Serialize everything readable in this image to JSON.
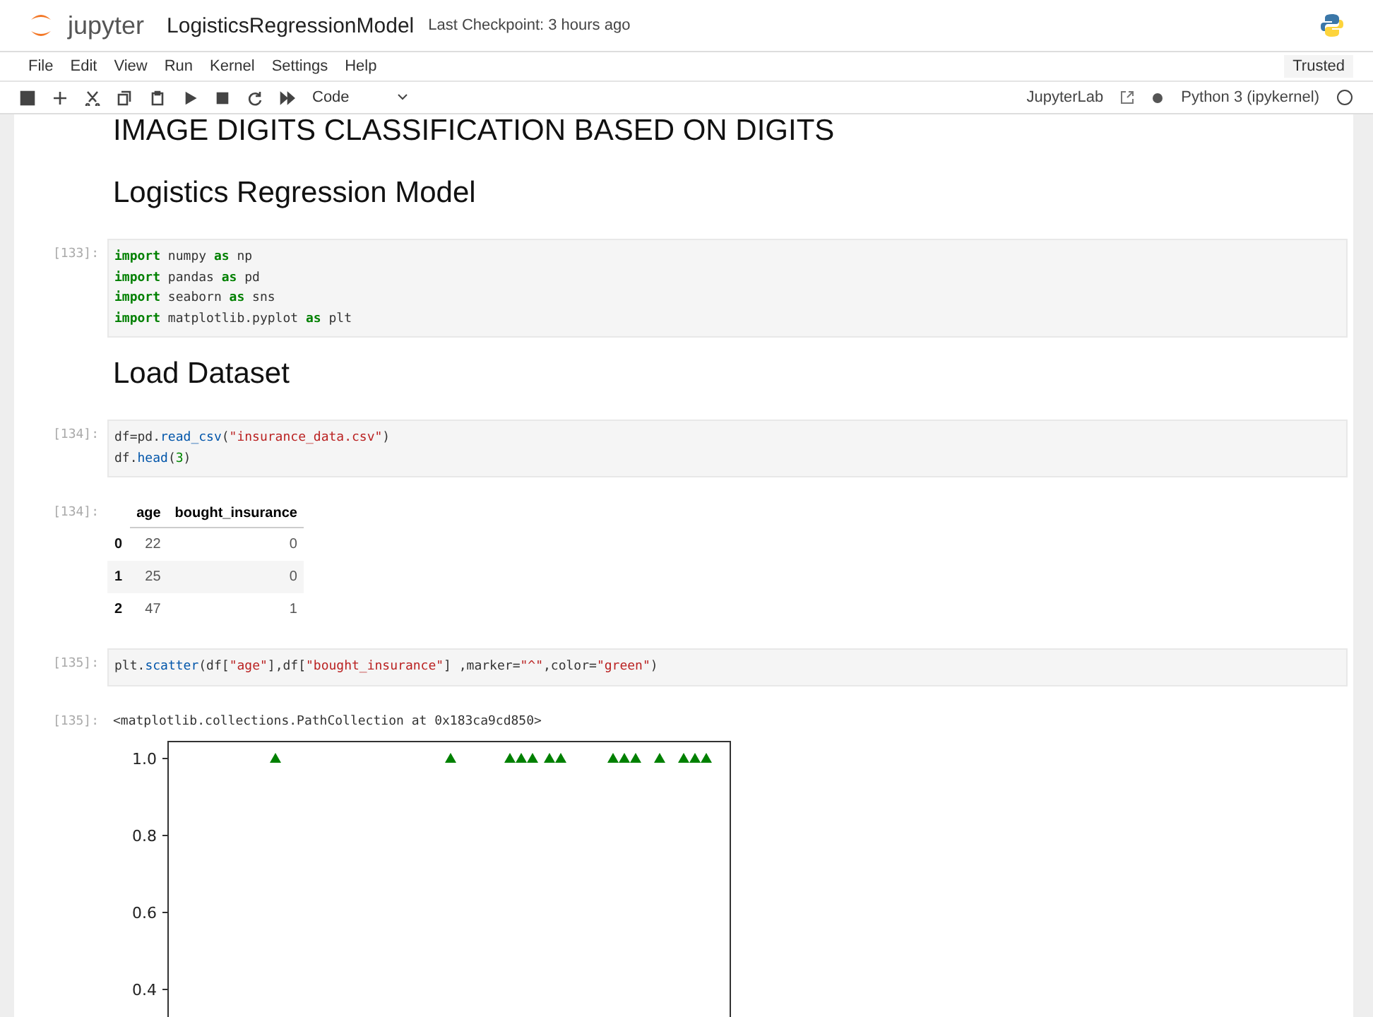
{
  "header": {
    "logo": "jupyter",
    "notebook_name": "LogisticsRegressionModel",
    "checkpoint": "Last Checkpoint: 3 hours ago"
  },
  "menu": [
    "File",
    "Edit",
    "View",
    "Run",
    "Kernel",
    "Settings",
    "Help"
  ],
  "trusted": "Trusted",
  "toolbar": {
    "cell_type": "Code",
    "jupyterlab": "JupyterLab",
    "kernel": "Python 3 (ipykernel)",
    "kernel_busy": false
  },
  "cells": [
    {
      "kind": "title",
      "text": "IMAGE DIGITS CLASSIFICATION BASED ON DIGITS"
    },
    {
      "kind": "heading",
      "text": "Logistics Regression Model"
    },
    {
      "kind": "code",
      "prompt": "[133]:",
      "lines": [
        [
          {
            "text": "import",
            "kind": "keyword"
          },
          {
            "text": " numpy ",
            "kind": "plain"
          },
          {
            "text": "as",
            "kind": "keyword"
          },
          {
            "text": " np",
            "kind": "plain"
          }
        ],
        [
          {
            "text": "import",
            "kind": "keyword"
          },
          {
            "text": " pandas ",
            "kind": "plain"
          },
          {
            "text": "as",
            "kind": "keyword"
          },
          {
            "text": " pd",
            "kind": "plain"
          }
        ],
        [
          {
            "text": "import",
            "kind": "keyword"
          },
          {
            "text": " seaborn ",
            "kind": "plain"
          },
          {
            "text": "as",
            "kind": "keyword"
          },
          {
            "text": " sns",
            "kind": "plain"
          }
        ],
        [
          {
            "text": "import",
            "kind": "keyword"
          },
          {
            "text": " matplotlib.pyplot ",
            "kind": "plain"
          },
          {
            "text": "as",
            "kind": "keyword"
          },
          {
            "text": " plt",
            "kind": "plain"
          }
        ]
      ]
    },
    {
      "kind": "heading",
      "text": "Load Dataset"
    },
    {
      "kind": "code",
      "prompt": "[134]:",
      "lines": [
        [
          {
            "text": "df=pd.",
            "kind": "plain"
          },
          {
            "text": "read_csv",
            "kind": "function"
          },
          {
            "text": "(",
            "kind": "plain"
          },
          {
            "text": "\"insurance_data.csv\"",
            "kind": "string"
          },
          {
            "text": ")",
            "kind": "plain"
          }
        ],
        [
          {
            "text": "df.",
            "kind": "plain"
          },
          {
            "text": "head",
            "kind": "function"
          },
          {
            "text": "(",
            "kind": "plain"
          },
          {
            "text": "3",
            "kind": "number"
          },
          {
            "text": ")",
            "kind": "plain"
          }
        ]
      ]
    },
    {
      "kind": "table",
      "prompt": "[134]:",
      "columns": [
        "age",
        "bought_insurance"
      ],
      "rows": [
        {
          "index": "0",
          "cells": [
            "22",
            "0"
          ]
        },
        {
          "index": "1",
          "cells": [
            "25",
            "0"
          ]
        },
        {
          "index": "2",
          "cells": [
            "47",
            "1"
          ]
        }
      ]
    },
    {
      "kind": "code",
      "prompt": "[135]:",
      "lines": [
        [
          {
            "text": "plt.",
            "kind": "plain"
          },
          {
            "text": "scatter",
            "kind": "function"
          },
          {
            "text": "(df[",
            "kind": "plain"
          },
          {
            "text": "\"age\"",
            "kind": "string"
          },
          {
            "text": "],df[",
            "kind": "plain"
          },
          {
            "text": "\"bought_insurance\"",
            "kind": "string"
          },
          {
            "text": "] ,marker=",
            "kind": "plain"
          },
          {
            "text": "\"^\"",
            "kind": "string"
          },
          {
            "text": ",color=",
            "kind": "plain"
          },
          {
            "text": "\"green\"",
            "kind": "string"
          },
          {
            "text": ")",
            "kind": "plain"
          }
        ]
      ]
    },
    {
      "kind": "text_output",
      "prompt": "[135]:",
      "text": "<matplotlib.collections.PathCollection at 0x183ca9cd850>"
    },
    {
      "kind": "plot",
      "y_ticks": [
        "1.0",
        "0.8",
        "0.6",
        "0.4"
      ]
    }
  ]
}
